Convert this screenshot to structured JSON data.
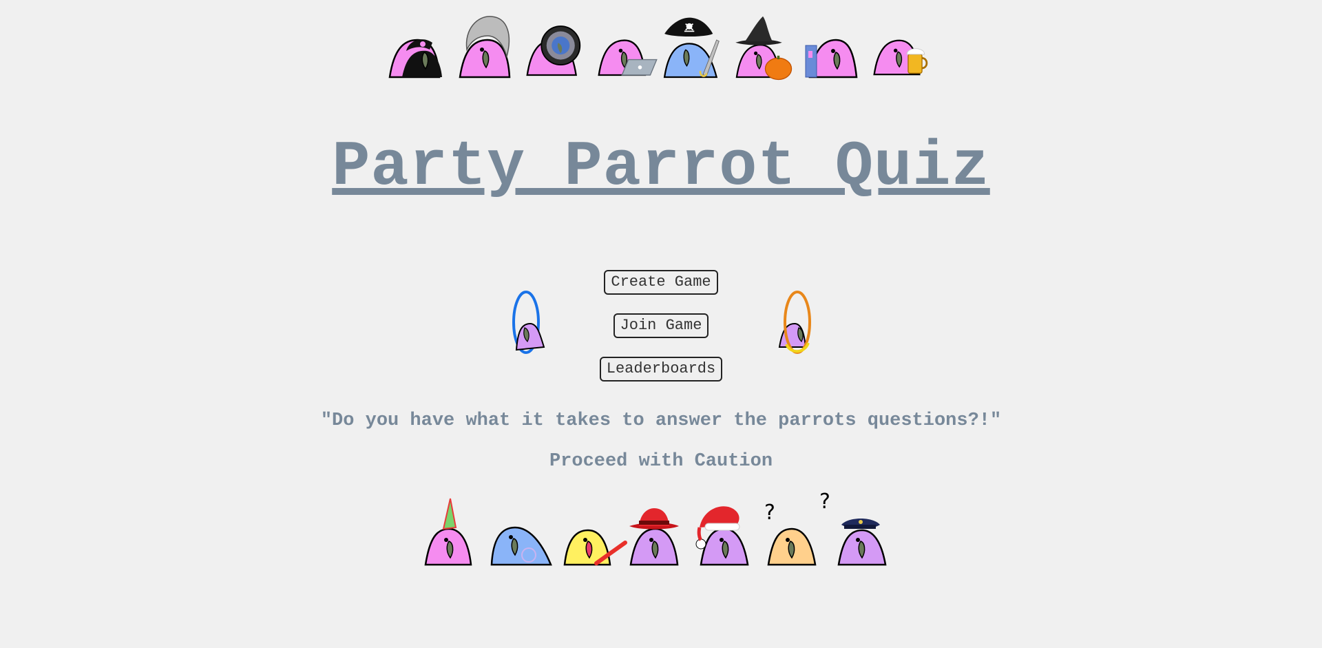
{
  "title": "Party Parrot Quiz",
  "menu": {
    "create_label": "Create Game",
    "join_label": "Join Game",
    "leaderboards_label": "Leaderboards"
  },
  "tagline": "\"Do you have what it takes to answer the parrots questions?!\"",
  "caution": "Proceed with Caution",
  "colors": {
    "background": "#f0f0f0",
    "title": "#778899",
    "parrot_pink": "#f58cf0",
    "parrot_blue": "#8ab4f8",
    "parrot_purple": "#d49af5",
    "parrot_yellow": "#fff060",
    "parrot_peach": "#ffd08c",
    "beak": "#6b7b5a",
    "portal_blue": "#1a73e8",
    "portal_orange": "#e8871a"
  },
  "top_parrots": [
    "pirate-bandana-parrot",
    "wig-parrot",
    "astronaut-parrot",
    "laptop-parrot",
    "pirate-captain-parrot",
    "witch-pumpkin-parrot",
    "book-parrot",
    "beer-parrot"
  ],
  "bottom_parrots": [
    "party-hat-parrot",
    "bubble-parrot",
    "banana-parrot-stick",
    "fedora-parrot",
    "santa-parrot",
    "confused-parrot",
    "police-parrot"
  ],
  "question_marks": [
    "?",
    "?"
  ]
}
